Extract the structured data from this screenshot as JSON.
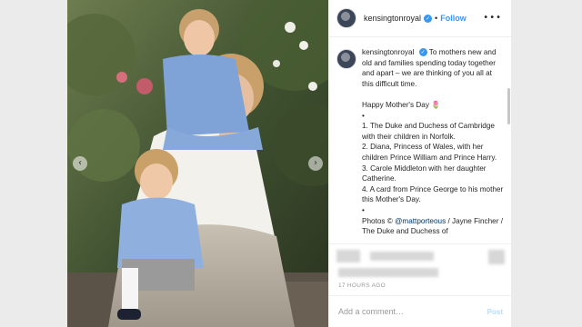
{
  "account": {
    "handle": "kensingtonroyal",
    "verified_mark": "✓",
    "dot": "•",
    "follow_label": "Follow",
    "more_icon": "•••"
  },
  "photo": {
    "description_icon": "family-photo",
    "nav_prev": "‹",
    "nav_next": "›"
  },
  "caption": {
    "intro": "To mothers new and old and families spending today together and apart – we are thinking of you all at this difficult time.",
    "greeting": "Happy Mother's Day 🌷",
    "bullet": "•",
    "items": [
      "1. The Duke and Duchess of Cambridge with their children in Norfolk.",
      "2. Diana, Princess of Wales, with her children Prince William and Prince Harry.",
      "3. Carole Middleton with her daughter Catherine.",
      "4. A card from Prince George to his mother this Mother's Day."
    ],
    "credits_prefix": "Photos © ",
    "credits_mention": "@mattporteous",
    "credits_rest": " / Jayne Fincher / The Duke and Duchess of"
  },
  "post_meta": {
    "timestamp": "17 HOURS AGO"
  },
  "comment": {
    "placeholder": "Add a comment…",
    "post_label": "Post"
  },
  "colors": {
    "accent": "#3897f0",
    "post_disabled": "#b2dffc",
    "text": "#262626",
    "muted": "#999999"
  }
}
